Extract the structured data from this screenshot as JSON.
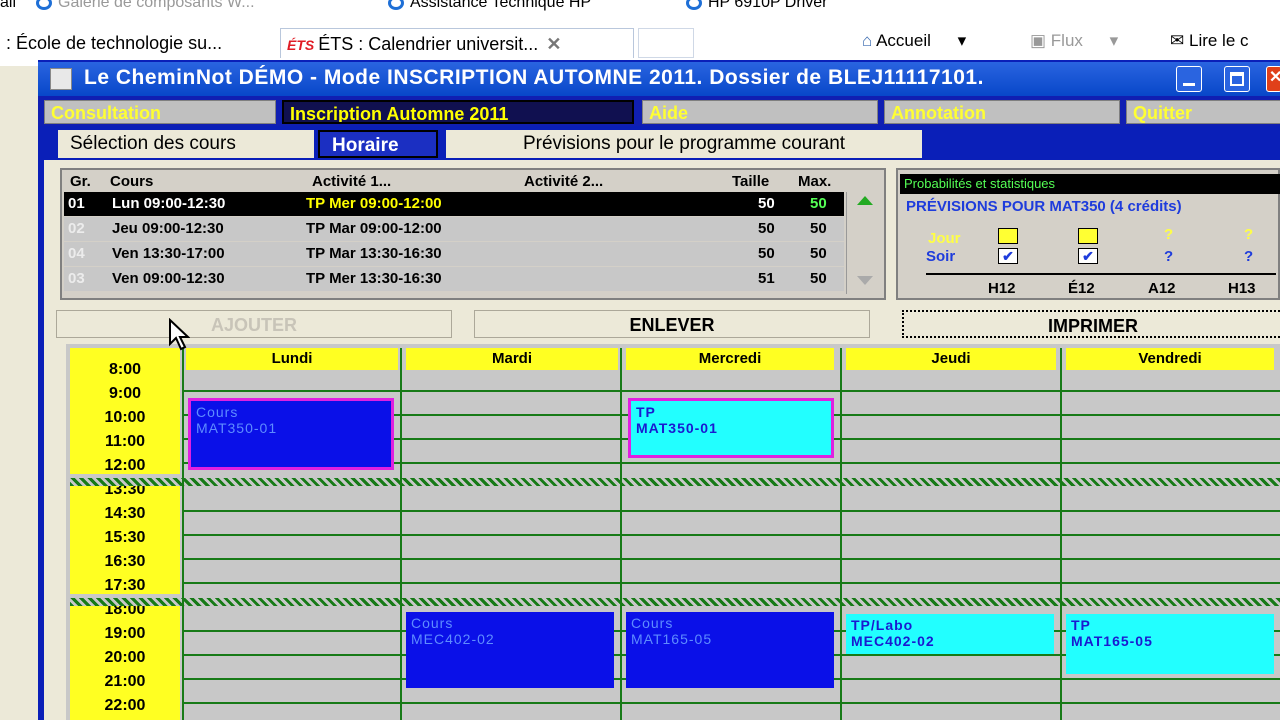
{
  "browser": {
    "bookmarks": [
      {
        "label": "ail",
        "faded": false
      },
      {
        "label": "Galerie de composants W...",
        "faded": true
      },
      {
        "label": "Assistance Technique HP",
        "faded": false
      },
      {
        "label": "HP 6910P Driver",
        "faded": false
      }
    ],
    "tabs": [
      {
        "label": ": École de technologie su...",
        "active": false
      },
      {
        "label": "ÉTS : Calendrier universit...",
        "active": true,
        "logo": "ÉTS"
      }
    ],
    "commands": {
      "home": "Accueil",
      "feeds": "Flux",
      "read_mail": "Lire le c"
    }
  },
  "app": {
    "title": "Le CheminNot DÉMO - Mode INSCRIPTION AUTOMNE 2011.  Dossier de BLEJ11117101.",
    "menu": [
      "Consultation",
      "Inscription Automne 2011",
      "Aide",
      "Annotation",
      "Quitter"
    ],
    "menu_selected": "Inscription Automne 2011",
    "tabs": [
      "Sélection des cours",
      "Horaire",
      "Prévisions pour le programme courant"
    ],
    "tab_selected": "Horaire"
  },
  "sections": {
    "headers": {
      "gr": "Gr.",
      "cours": "Cours",
      "act1": "Activité 1...",
      "act2": "Activité 2...",
      "taille": "Taille",
      "max": "Max."
    },
    "rows": [
      {
        "gr": "01",
        "cours": "Lun 09:00-12:30",
        "act1": "TP Mer 09:00-12:00",
        "act2": "",
        "taille": "50",
        "max": "50",
        "selected": true
      },
      {
        "gr": "02",
        "cours": "Jeu 09:00-12:30",
        "act1": "TP Mar 09:00-12:00",
        "act2": "",
        "taille": "50",
        "max": "50",
        "selected": false
      },
      {
        "gr": "04",
        "cours": "Ven 13:30-17:00",
        "act1": "TP Mar 13:30-16:30",
        "act2": "",
        "taille": "50",
        "max": "50",
        "selected": false
      },
      {
        "gr": "03",
        "cours": "Ven 09:00-12:30",
        "act1": "TP Mer 13:30-16:30",
        "act2": "",
        "taille": "51",
        "max": "50",
        "selected": false
      }
    ]
  },
  "stats": {
    "header": "Probabilités et statistiques",
    "title": "PRÉVISIONS POUR MAT350 (4 crédits)",
    "labels": {
      "jour": "Jour",
      "soir": "Soir"
    },
    "terms": [
      "H12",
      "É12",
      "A12",
      "H13"
    ],
    "unknown": "?",
    "check": "✔"
  },
  "buttons": {
    "add": "AJOUTER",
    "remove": "ENLEVER",
    "print": "IMPRIMER"
  },
  "schedule": {
    "days": [
      "Lundi",
      "Mardi",
      "Mercredi",
      "Jeudi",
      "Vendredi"
    ],
    "times": [
      "8:00",
      "9:00",
      "10:00",
      "11:00",
      "12:00",
      "13:30",
      "14:30",
      "15:30",
      "16:30",
      "17:30",
      "18:00",
      "19:00",
      "20:00",
      "21:00",
      "22:00"
    ],
    "blocks": [
      {
        "type": "Cours",
        "code": "MAT350-01"
      },
      {
        "type": "TP",
        "code": "MAT350-01"
      },
      {
        "type": "Cours",
        "code": "MEC402-02"
      },
      {
        "type": "Cours",
        "code": "MAT165-05"
      },
      {
        "type": "TP/Labo",
        "code": "MEC402-02"
      },
      {
        "type": "TP",
        "code": "MAT165-05"
      }
    ]
  }
}
